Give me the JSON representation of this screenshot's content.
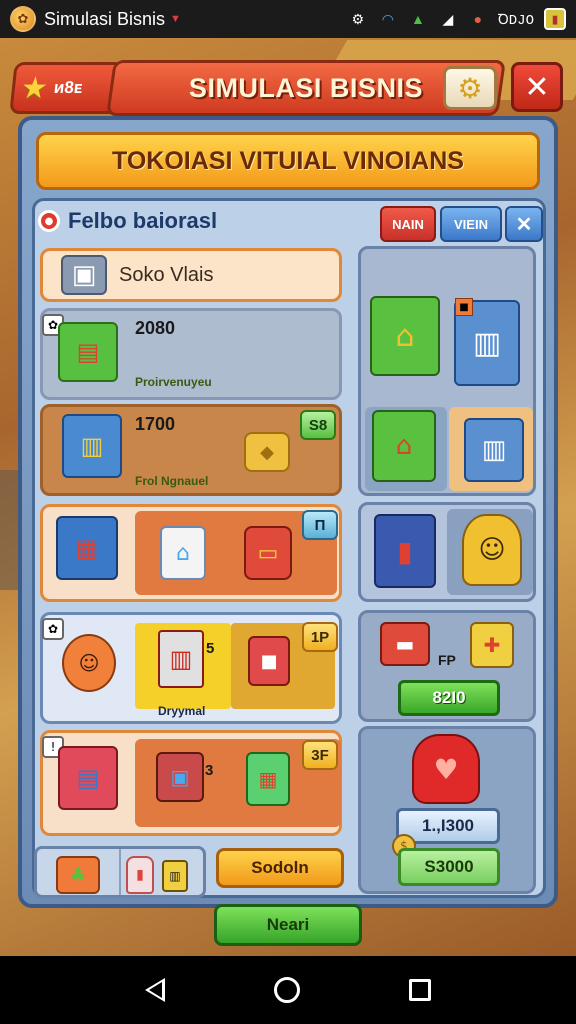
{
  "status_bar": {
    "app_title": "Simulasi Bisnis",
    "battery_text": "ꝹDJO"
  },
  "header": {
    "left_label": "ᴎ8ᴇ",
    "title": "SIMULASI BISNIS"
  },
  "banner": {
    "title": "TOKOIASI VITUIAL VINOIANS"
  },
  "section": {
    "title": "Felbo baiorasl",
    "tabs": [
      "NAIN",
      "VIEIN",
      "✕"
    ]
  },
  "list": {
    "top_item": "Soko Vlais",
    "row1": {
      "value": "2080",
      "label": "Proirvenuyeu"
    },
    "row2": {
      "value": "1700",
      "label": "Frol Ngnauel",
      "badge": "S8"
    },
    "row3": {
      "badge": "П"
    },
    "row4": {
      "amount": "5",
      "label": "Dryymal",
      "badge": "1P"
    },
    "row5": {
      "amount": "3",
      "badge": "3F"
    }
  },
  "right": {
    "rc3_label": "FP",
    "price_green": "82I0",
    "price_blue": "1.,I300",
    "price_total": "S3000"
  },
  "buttons": {
    "save": "Sodoln",
    "next": "Neari"
  },
  "colors": {
    "accent_red": "#e0402a",
    "accent_orange": "#f39a1a",
    "accent_green": "#3aa828",
    "panel_blue": "#6c8cb6"
  }
}
